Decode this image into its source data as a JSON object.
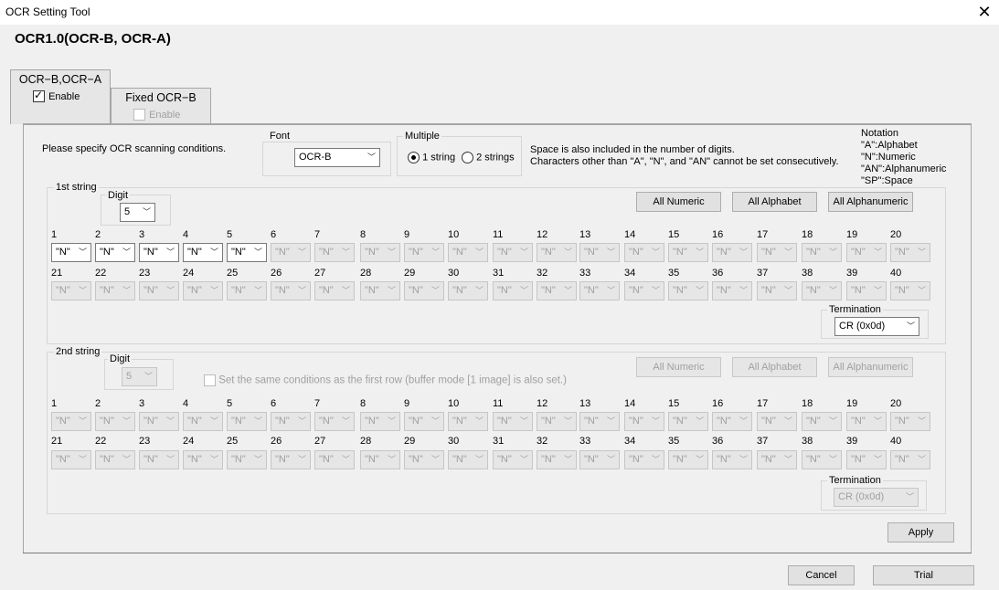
{
  "window": {
    "title": "OCR Setting Tool",
    "close_glyph": "✕"
  },
  "heading": "OCR1.0(OCR-B, OCR-A)",
  "tabs": [
    {
      "label": "OCR−B,OCR−A",
      "checkbox_label": "Enable",
      "checked": true,
      "enabled": true
    },
    {
      "label": "Fixed OCR−B",
      "checkbox_label": "Enable",
      "checked": false,
      "enabled": false
    }
  ],
  "instructions": "Please specify OCR scanning conditions.",
  "font": {
    "label": "Font",
    "value": "OCR-B"
  },
  "multiple": {
    "label": "Multiple",
    "option1": "1 string",
    "option2": "2 strings",
    "selected": "1 string"
  },
  "space_note": {
    "line1": "Space is also included in the number of digits.",
    "line2": "Characters other than \"A\", \"N\", and \"AN\" cannot be set consecutively."
  },
  "notation": {
    "title": "Notation",
    "lines": [
      "\"A\":Alphabet",
      "\"N\":Numeric",
      "\"AN\":Alphanumeric",
      "\"SP\":Space"
    ]
  },
  "string1": {
    "label": "1st string",
    "digit_label": "Digit",
    "digit_value": "5",
    "buttons": {
      "numeric": "All Numeric",
      "alphabet": "All Alphabet",
      "alphanumeric": "All Alphanumeric"
    },
    "cell_value": "\"N\"",
    "active_count": 5,
    "termination_label": "Termination",
    "termination_value": "CR (0x0d)"
  },
  "string2": {
    "label": "2nd string",
    "digit_label": "Digit",
    "digit_value": "5",
    "same_conditions": "Set the same conditions as the first row (buffer mode [1 image] is also set.)",
    "buttons": {
      "numeric": "All Numeric",
      "alphabet": "All Alphabet",
      "alphanumeric": "All Alphanumeric"
    },
    "cell_value": "\"N\"",
    "active_count": 0,
    "termination_label": "Termination",
    "termination_value": "CR (0x0d)"
  },
  "position_numbers": [
    "1",
    "2",
    "3",
    "4",
    "5",
    "6",
    "7",
    "8",
    "9",
    "10",
    "11",
    "12",
    "13",
    "14",
    "15",
    "16",
    "17",
    "18",
    "19",
    "20",
    "21",
    "22",
    "23",
    "24",
    "25",
    "26",
    "27",
    "28",
    "29",
    "30",
    "31",
    "32",
    "33",
    "34",
    "35",
    "36",
    "37",
    "38",
    "39",
    "40"
  ],
  "buttons": {
    "apply": "Apply",
    "cancel": "Cancel",
    "trial": "Trial"
  },
  "icons": {
    "dropdown": "chevron-down-icon",
    "close": "close-icon",
    "check": "check-icon"
  }
}
